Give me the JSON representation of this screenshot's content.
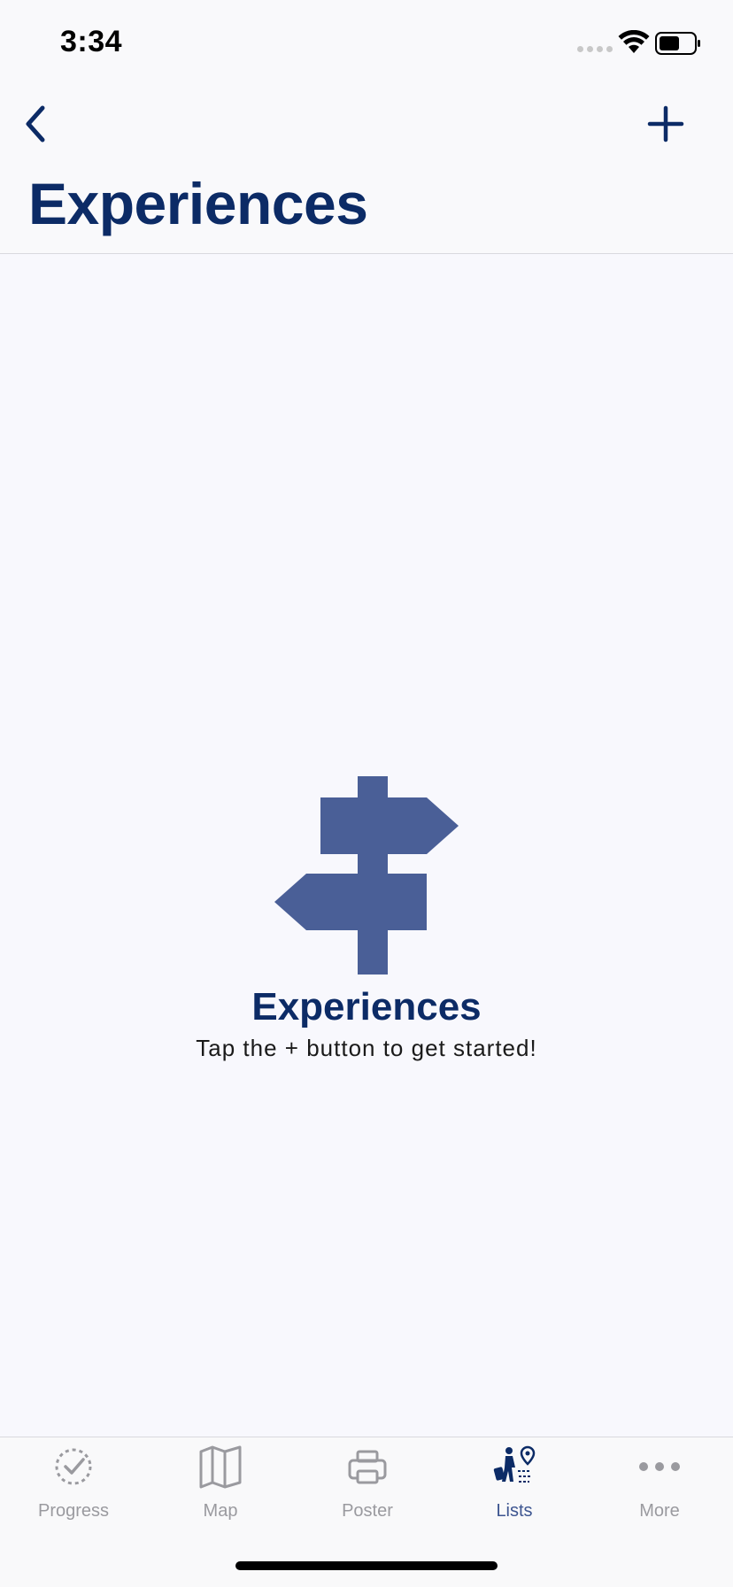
{
  "status_bar": {
    "time": "3:34"
  },
  "header": {
    "title": "Experiences",
    "back_icon": "chevron-left-icon",
    "add_icon": "plus-icon"
  },
  "empty_state": {
    "icon": "signpost-icon",
    "title": "Experiences",
    "subtitle": "Tap the + button to get started!"
  },
  "tab_bar": {
    "items": [
      {
        "label": "Progress",
        "icon": "progress-check-icon",
        "active": false
      },
      {
        "label": "Map",
        "icon": "map-icon",
        "active": false
      },
      {
        "label": "Poster",
        "icon": "printer-icon",
        "active": false
      },
      {
        "label": "Lists",
        "icon": "traveler-pin-icon",
        "active": true
      },
      {
        "label": "More",
        "icon": "more-dots-icon",
        "active": false
      }
    ]
  },
  "colors": {
    "accent": "#0c2b66",
    "illustration": "#4a5f97",
    "tab_inactive": "#9a9a9f",
    "tab_active": "#3d5590",
    "background": "#f8f8fd"
  }
}
